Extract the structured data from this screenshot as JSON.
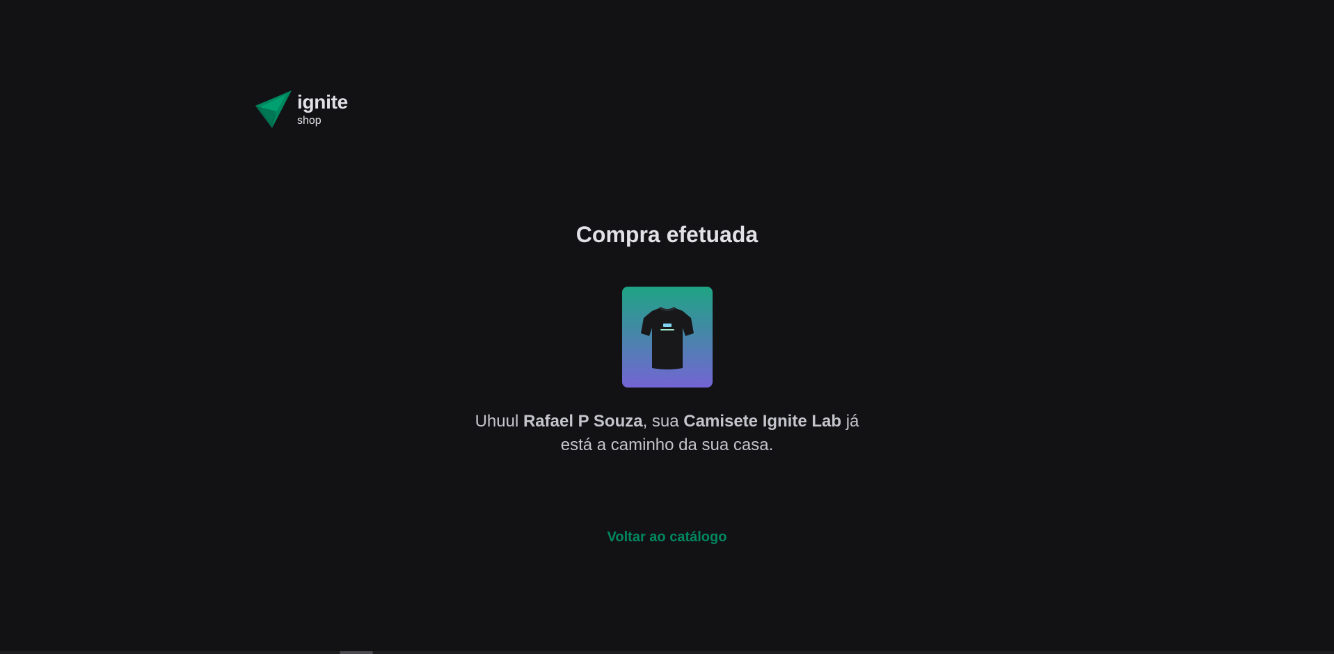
{
  "header": {
    "logo_title": "ignite",
    "logo_subtitle": "shop"
  },
  "main": {
    "title": "Compra efetuada",
    "product_image_icon": "tshirt-icon",
    "message": {
      "prefix": "Uhuul ",
      "customer_name": "Rafael P Souza",
      "middle": ", sua ",
      "product_name": "Camisete Ignite Lab",
      "suffix": " já está a caminho da sua casa."
    },
    "back_link_label": "Voltar ao catálogo"
  },
  "colors": {
    "background": "#121214",
    "text": "#e1e1e6",
    "text_secondary": "#c4c4cc",
    "accent": "#00875f",
    "gradient_start": "#1ea483",
    "gradient_end": "#7465d4"
  }
}
